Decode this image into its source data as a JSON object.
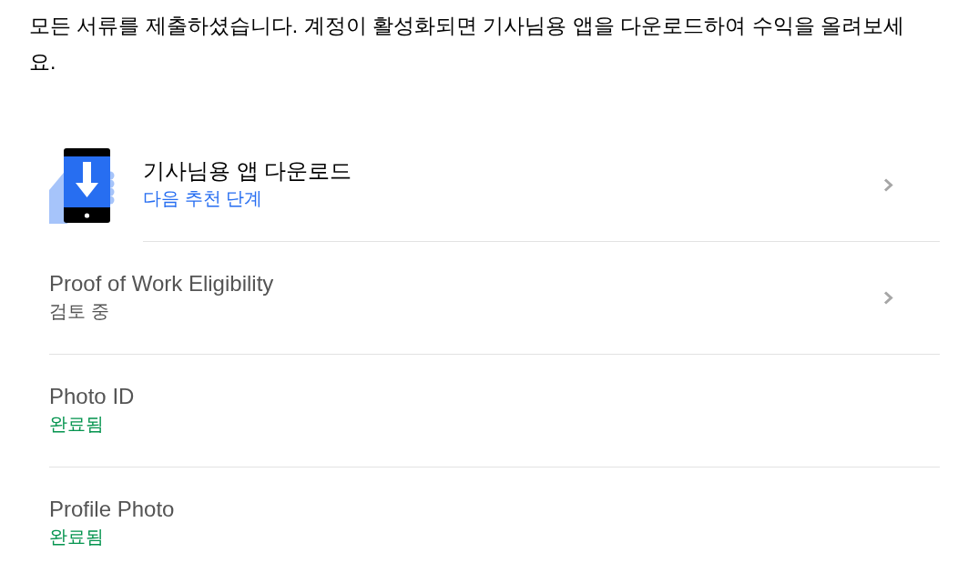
{
  "intro": "모든 서류를 제출하셨습니다. 계정이 활성화되면 기사님용 앱을 다운로드하여 수익을 올려보세요.",
  "steps": [
    {
      "kind": "app_download",
      "title": "기사님용 앱 다운로드",
      "status": "다음 추천 단계",
      "color": "#276ef1",
      "chevron": true
    },
    {
      "kind": "document",
      "title": "Proof of Work Eligibility",
      "status": "검토 중",
      "color": "#545454",
      "chevron": true
    },
    {
      "kind": "document",
      "title": "Photo ID",
      "status": "완료됨",
      "color": "#05944f",
      "chevron": false
    },
    {
      "kind": "document",
      "title": "Profile Photo",
      "status": "완료됨",
      "color": "#05944f",
      "chevron": false
    }
  ]
}
